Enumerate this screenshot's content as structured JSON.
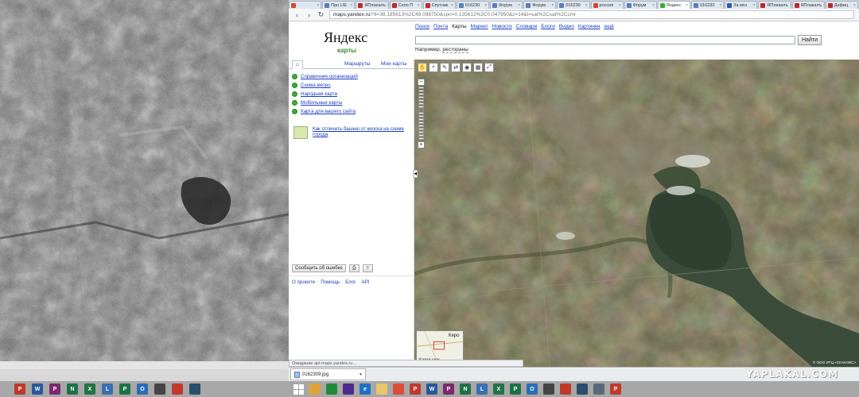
{
  "browser": {
    "tabs": [
      {
        "label": "",
        "color": "#d6462c"
      },
      {
        "label": "Про LIE",
        "color": "#5a7fb8"
      },
      {
        "label": "ЯПлакалъ",
        "color": "#c0282b"
      },
      {
        "label": "Село П",
        "color": "#c0282b"
      },
      {
        "label": "Спутник",
        "color": "#c0282b"
      },
      {
        "label": "016230",
        "color": "#5a7fb8"
      },
      {
        "label": "Форум",
        "color": "#5a7fb8"
      },
      {
        "label": "Форум",
        "color": "#5a7fb8"
      },
      {
        "label": "016230",
        "color": "#5a7fb8"
      },
      {
        "label": "россия",
        "color": "#d6462c"
      },
      {
        "label": "Форум",
        "color": "#5a7fb8"
      },
      {
        "label": "Яндекс",
        "color": "#3ea935",
        "active": true
      },
      {
        "label": "016230",
        "color": "#5a7fb8"
      },
      {
        "label": "За мгн",
        "color": "#2d5da8"
      },
      {
        "label": "ЯПлакалъ",
        "color": "#c0282b"
      },
      {
        "label": "ЯПлакалъ",
        "color": "#c0282b"
      },
      {
        "label": "Дефиц",
        "color": "#c0282b"
      }
    ],
    "url_host": "maps.yandex.ru",
    "url_rest": "/?ll=38.185613%2C48.098750&spn=0.135612%2C0.047950&z=14&l=sat%2Csat%2Ccmr"
  },
  "yandex": {
    "logo": "Яндекс",
    "logo_sub": "карты",
    "services": [
      {
        "label": "Поиск"
      },
      {
        "label": "Почта"
      },
      {
        "label": "Карты",
        "current": true
      },
      {
        "label": "Маркет"
      },
      {
        "label": "Новости"
      },
      {
        "label": "Словари"
      },
      {
        "label": "Блоги"
      },
      {
        "label": "Видео"
      },
      {
        "label": "Картинки"
      },
      {
        "label": "ещё"
      }
    ],
    "search_button": "Найти",
    "example_prefix": "Например,",
    "example_link": "рестораны"
  },
  "panel": {
    "tabs": [
      "Маршруты",
      "Мои карты"
    ],
    "links": [
      "Справочник организаций",
      "Схема метро",
      "Народная карта",
      "Мобильные карты",
      "Карта для вашего сайта"
    ],
    "promo": "Как отличить башню от киоска на схеме города",
    "report_button": "Сообщить об ошибке",
    "footer": [
      "О проекте",
      "Помощь",
      "Блог",
      "API"
    ]
  },
  "map": {
    "minimap_labels": [
      "Киро",
      "Харцызск"
    ],
    "copyright": "© ООО ИТЦ «СКАНЭКС»"
  },
  "status": "Ожидание api-maps.yandex.ru...",
  "download": {
    "filename": "0162309.jpg"
  },
  "watermark": "YAPLAKAL.COM",
  "taskbar_left": [
    {
      "label": "P",
      "color": "#c0392b"
    },
    {
      "label": "W",
      "color": "#2b579a"
    },
    {
      "label": "P",
      "color": "#7a2a6e"
    },
    {
      "label": "N",
      "color": "#1e7145"
    },
    {
      "label": "X",
      "color": "#217346"
    },
    {
      "label": "L",
      "color": "#3a6fb0"
    },
    {
      "label": "P",
      "color": "#1e7145"
    },
    {
      "label": "O",
      "color": "#2a6db5"
    },
    {
      "label": "",
      "color": "#444444"
    },
    {
      "label": "",
      "color": "#c0392b"
    },
    {
      "label": "",
      "color": "#2a4d6a"
    }
  ],
  "taskbar_right": [
    {
      "label": "",
      "color": "#e0a33a"
    },
    {
      "label": "",
      "color": "#1e8a3a"
    },
    {
      "label": "",
      "color": "#4b2c8a"
    },
    {
      "label": "e",
      "color": "#1f6fc5"
    },
    {
      "label": "",
      "color": "#e8c66a"
    },
    {
      "label": "",
      "color": "#dd4b39"
    },
    {
      "label": "P",
      "color": "#c0392b"
    },
    {
      "label": "W",
      "color": "#2b579a"
    },
    {
      "label": "P",
      "color": "#7a2a6e"
    },
    {
      "label": "N",
      "color": "#1e7145"
    },
    {
      "label": "L",
      "color": "#3a6fb0"
    },
    {
      "label": "X",
      "color": "#217346"
    },
    {
      "label": "P",
      "color": "#1e7145"
    },
    {
      "label": "O",
      "color": "#2a6db5"
    },
    {
      "label": "",
      "color": "#444444"
    },
    {
      "label": "",
      "color": "#c0392b"
    },
    {
      "label": "",
      "color": "#2a4d6a"
    },
    {
      "label": "",
      "color": "#5a6a7a"
    },
    {
      "label": "P",
      "color": "#c0392b"
    }
  ]
}
